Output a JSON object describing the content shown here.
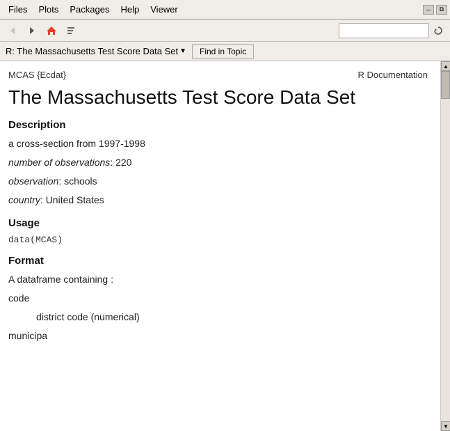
{
  "menu": {
    "items": [
      "Files",
      "Plots",
      "Packages",
      "Help",
      "Viewer"
    ]
  },
  "toolbar": {
    "back_title": "Back",
    "forward_title": "Forward",
    "home_title": "Home",
    "history_title": "History",
    "search_placeholder": "",
    "refresh_title": "Refresh"
  },
  "location": {
    "text": "R: The Massachusetts Test Score Data Set",
    "find_topic_label": "Find in Topic"
  },
  "doc": {
    "header_left": "MCAS {Ecdat}",
    "header_right": "R Documentation",
    "title": "The Massachusetts Test Score Data Set",
    "description_heading": "Description",
    "description_line1": "a cross-section from 1997-1998",
    "description_line2_prefix": "number of observations",
    "description_line2_suffix": ": 220",
    "description_line3_prefix": "observation",
    "description_line3_suffix": ": schools",
    "description_line4_prefix": "country",
    "description_line4_suffix": ": United States",
    "usage_heading": "Usage",
    "usage_code": "data(MCAS)",
    "format_heading": "Format",
    "format_intro": "A dataframe containing :",
    "format_field1_name": "code",
    "format_field1_desc": "district code (numerical)",
    "format_field2_name": "municipa"
  },
  "window_controls": {
    "minimize": "─",
    "maximize": "□",
    "restore": ""
  }
}
